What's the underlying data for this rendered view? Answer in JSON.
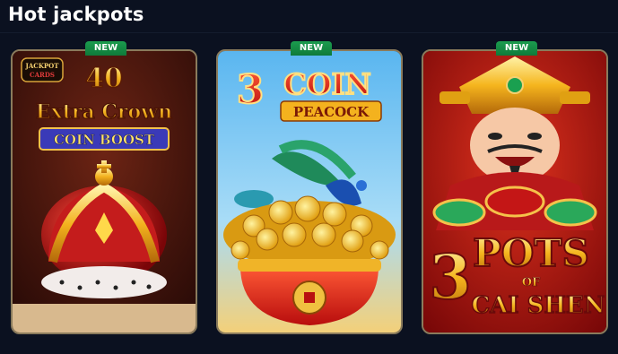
{
  "section": {
    "title": "Hot jackpots"
  },
  "games": [
    {
      "badge": "NEW",
      "logo_line1": "JACKPOT",
      "logo_line2": "CARDS",
      "title_number": "40",
      "title_main": "Extra Crown",
      "title_sub": "COIN BOOST"
    },
    {
      "badge": "NEW",
      "title_number": "3",
      "title_main": "COIN",
      "title_sub": "PEACOCK"
    },
    {
      "badge": "NEW",
      "title_number": "3",
      "title_main": "POTS",
      "title_of": "OF",
      "title_sub": "CAI SHEN"
    }
  ],
  "colors": {
    "background": "#0b1120",
    "badge": "#1b9c4e"
  }
}
